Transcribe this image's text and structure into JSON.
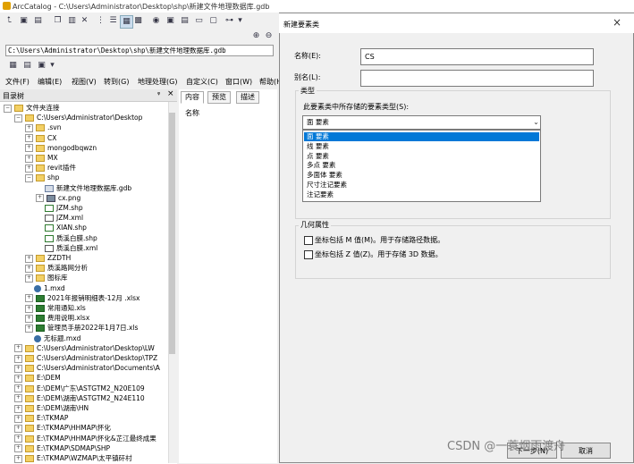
{
  "app": {
    "title": "ArcCatalog - C:\\Users\\Administrator\\Desktop\\shp\\新建文件地理数据库.gdb",
    "location": "C:\\Users\\Administrator\\Desktop\\shp\\新建文件地理数据库.gdb"
  },
  "menubar": {
    "items": [
      "文件(F)",
      "编辑(E)",
      "视图(V)",
      "转到(G)",
      "地理处理(G)",
      "自定义(C)",
      "窗口(W)",
      "帮助(H)"
    ]
  },
  "tree": {
    "header": "目录树",
    "pin": "ᵠ",
    "close": "×",
    "rows": [
      {
        "label": "文件夹连接",
        "exp": "−",
        "icon": "folder"
      },
      {
        "label": "C:\\Users\\Administrator\\Desktop",
        "exp": "−",
        "icon": "folder"
      },
      {
        "label": ".svn",
        "exp": "+",
        "icon": "folder"
      },
      {
        "label": "CX",
        "exp": "+",
        "icon": "folder"
      },
      {
        "label": "mongodbqwzn",
        "exp": "+",
        "icon": "folder"
      },
      {
        "label": "MX",
        "exp": "+",
        "icon": "folder"
      },
      {
        "label": "revit插件",
        "exp": "+",
        "icon": "folder"
      },
      {
        "label": "shp",
        "exp": "−",
        "icon": "folder"
      },
      {
        "label": "新建文件地理数据库.gdb",
        "exp": "",
        "icon": "gdb"
      },
      {
        "label": "cx.png",
        "exp": "+",
        "icon": "png"
      },
      {
        "label": "JZM.shp",
        "exp": "",
        "icon": "shp"
      },
      {
        "label": "JZM.xml",
        "exp": "",
        "icon": "xml"
      },
      {
        "label": "XIAN.shp",
        "exp": "",
        "icon": "shp"
      },
      {
        "label": "质溪白膜.shp",
        "exp": "",
        "icon": "shp"
      },
      {
        "label": "质溪白膜.xml",
        "exp": "",
        "icon": "xml"
      },
      {
        "label": "ZZDTH",
        "exp": "+",
        "icon": "folder"
      },
      {
        "label": "质溪路网分析",
        "exp": "+",
        "icon": "folder"
      },
      {
        "label": "图标库",
        "exp": "+",
        "icon": "folder"
      },
      {
        "label": "1.mxd",
        "exp": "",
        "icon": "mxd"
      },
      {
        "label": "2021年报销明细表-12月 .xlsx",
        "exp": "+",
        "icon": "xls"
      },
      {
        "label": "常用通知.xls",
        "exp": "+",
        "icon": "xls"
      },
      {
        "label": "费用说明.xlsx",
        "exp": "+",
        "icon": "xls"
      },
      {
        "label": "管理员手册2022年1月7日.xls",
        "exp": "+",
        "icon": "xls"
      },
      {
        "label": "无标题.mxd",
        "exp": "",
        "icon": "mxd"
      },
      {
        "label": "C:\\Users\\Administrator\\Desktop\\LW",
        "exp": "+",
        "icon": "folder"
      },
      {
        "label": "C:\\Users\\Administrator\\Desktop\\TPZ",
        "exp": "+",
        "icon": "folder"
      },
      {
        "label": "C:\\Users\\Administrator\\Documents\\A",
        "exp": "+",
        "icon": "folder"
      },
      {
        "label": "E:\\DEM",
        "exp": "+",
        "icon": "folder"
      },
      {
        "label": "E:\\DEM\\广东\\ASTGTM2_N20E109",
        "exp": "+",
        "icon": "folder"
      },
      {
        "label": "E:\\DEM\\湖南\\ASTGTM2_N24E110",
        "exp": "+",
        "icon": "folder"
      },
      {
        "label": "E:\\DEM\\湖南\\HN",
        "exp": "+",
        "icon": "folder"
      },
      {
        "label": "E:\\TKMAP",
        "exp": "+",
        "icon": "folder"
      },
      {
        "label": "E:\\TKMAP\\HHMAP\\怀化",
        "exp": "+",
        "icon": "folder"
      },
      {
        "label": "E:\\TKMAP\\HHMAP\\怀化&芷江最终成果",
        "exp": "+",
        "icon": "folder"
      },
      {
        "label": "E:\\TKMAP\\SDMAP\\SHP",
        "exp": "+",
        "icon": "folder"
      },
      {
        "label": "E:\\TKMAP\\WZMAP\\太平镇矸村",
        "exp": "+",
        "icon": "folder"
      }
    ]
  },
  "content": {
    "tabs": [
      "内容",
      "预览",
      "描述"
    ],
    "column_name": "名称"
  },
  "dialog": {
    "title": "新建要素类",
    "close": "×",
    "name_label": "名称(E):",
    "name_value": "CS",
    "alias_label": "别名(L):",
    "alias_value": "",
    "type_group": "类型",
    "type_prompt": "此要素类中所存储的要素类型(S):",
    "type_selected": "面 要素",
    "type_options": [
      "面 要素",
      "线 要素",
      "点 要素",
      "多点 要素",
      "多面体 要素",
      "尺寸注记要素",
      "注记要素"
    ],
    "geometry_group": "几何属性",
    "m_values_label": "坐标包括 M 值(M)。用于存储路径数据。",
    "z_values_label": "坐标包括 Z 值(Z)。用于存储 3D 数据。",
    "next_button": "下一步(N)",
    "cancel_button": "取消"
  },
  "watermark": "CSDN @一蓑烟雨渡舟",
  "colors": {
    "selection": "#0078d7",
    "folder": "#f3d064"
  }
}
